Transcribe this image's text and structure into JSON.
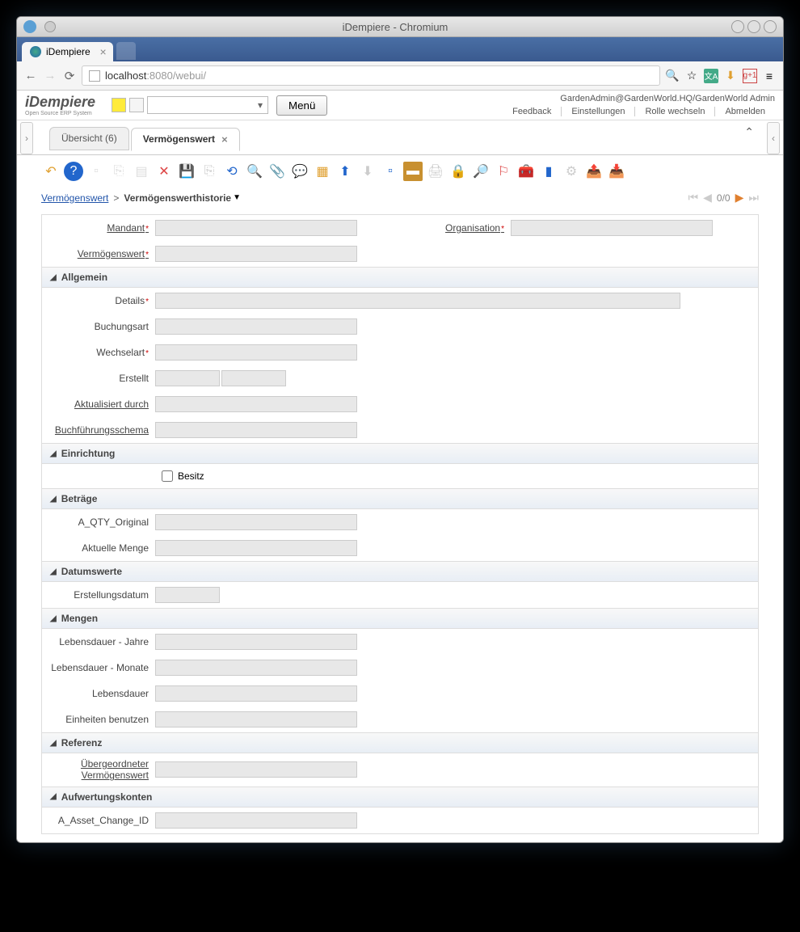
{
  "window": {
    "title": "iDempiere - Chromium"
  },
  "browserTab": {
    "label": "iDempiere"
  },
  "url": {
    "host": "localhost",
    "port": ":8080",
    "path": "/webui/"
  },
  "logo": {
    "main": "iDempiere",
    "sub": "Open Source ERP System"
  },
  "menuButton": "Menü",
  "userContext": "GardenAdmin@GardenWorld.HQ/GardenWorld Admin",
  "headerLinks": {
    "feedback": "Feedback",
    "settings": "Einstellungen",
    "changeRole": "Rolle wechseln",
    "logout": "Abmelden"
  },
  "appTabs": {
    "overview": "Übersicht (6)",
    "asset": "Vermögenswert"
  },
  "breadcrumb": {
    "root": "Vermögenswert",
    "current": "Vermögenswerthistorie"
  },
  "paging": {
    "text": "0/0"
  },
  "labels": {
    "mandant": "Mandant",
    "organisation": "Organisation",
    "vermoegenswert": "Vermögenswert",
    "details": "Details",
    "buchungsart": "Buchungsart",
    "wechselart": "Wechselart",
    "erstellt": "Erstellt",
    "aktualisiertDurch": "Aktualisiert durch",
    "buchfuehrungsschema": "Buchführungsschema",
    "besitz": "Besitz",
    "aQtyOriginal": "A_QTY_Original",
    "aktuelleMenge": "Aktuelle Menge",
    "erstellungsdatum": "Erstellungsdatum",
    "lebensdauerJahre": "Lebensdauer - Jahre",
    "lebensdauerMonate": "Lebensdauer - Monate",
    "lebensdauer": "Lebensdauer",
    "einheitenBenutzen": "Einheiten benutzen",
    "uebergeordneterVermoegenswert": "Übergeordneter Vermögenswert",
    "aAssetChangeId": "A_Asset_Change_ID"
  },
  "sections": {
    "allgemein": "Allgemein",
    "einrichtung": "Einrichtung",
    "betraege": "Beträge",
    "datumswerte": "Datumswerte",
    "mengen": "Mengen",
    "referenz": "Referenz",
    "aufwertungskonten": "Aufwertungskonten"
  }
}
